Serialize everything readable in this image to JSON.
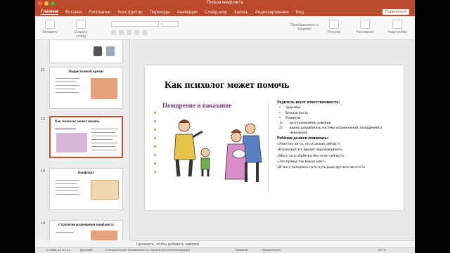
{
  "window": {
    "title": "Польза конфликта"
  },
  "ribbon": {
    "tabs": [
      "Главная",
      "Вставка",
      "Рисование",
      "Конструктор",
      "Переходы",
      "Анимация",
      "Слайд-шоу",
      "Запись",
      "Рецензирование",
      "Вид"
    ],
    "active_tab": 0,
    "share_label": "Поделиться",
    "tools": {
      "paste": "Вставить",
      "new_slide": "Создать слайд",
      "convert_smartart": "Преобразовать в SmartArt",
      "picture": "Рисунок",
      "drawing": "Рисование",
      "addins": "Надстройки"
    }
  },
  "thumbnails": [
    {
      "number": "11",
      "title": "Подростковый кризис"
    },
    {
      "number": "12",
      "title": "Как психолог может помочь",
      "selected": true
    },
    {
      "number": "13",
      "title": "Конфликт"
    },
    {
      "number": "14",
      "title": "Стратегии разрешения конфликта"
    }
  ],
  "slide": {
    "title": "Как психолог может помочь",
    "subtitle": "Поощрение и наказание",
    "heading1": "Родитель несет ответственность:",
    "bullets": [
      "Здоровье",
      "Безопасность",
      "Развитие"
    ],
    "numbered": [
      {
        "n": "1)",
        "text": "восстановление доверия"
      },
      {
        "n": "2)",
        "text": "важно разработать систему ограничений, поощрений и наказаний."
      }
    ],
    "heading2": "Ребёнок должен понимать:",
    "questions": [
      "«Уместно ли то, что я делаю сейчас?»",
      "«Насколько это вредит окружающим?»",
      "«Могу ли я обойтись без этого сейчас?»",
      "«Это правда так важно мне?»",
      "«Я могу потерпеть чуть-чуть ради другого/чего-то?»"
    ]
  },
  "notes": {
    "placeholder": "Щелкните, чтобы добавить заметки"
  },
  "status": {
    "slide_info": "Слайд 12 из 21",
    "language": "русский",
    "accessibility": "Специальные возможности: проверьте рекомендации",
    "notes_btn": "Заметки",
    "comments_btn": "Примечания",
    "zoom": "87 %"
  },
  "colors": {
    "accent": "#ba4a2b",
    "subtitle": "#7b2d7a",
    "dots": "#7fb63b"
  }
}
